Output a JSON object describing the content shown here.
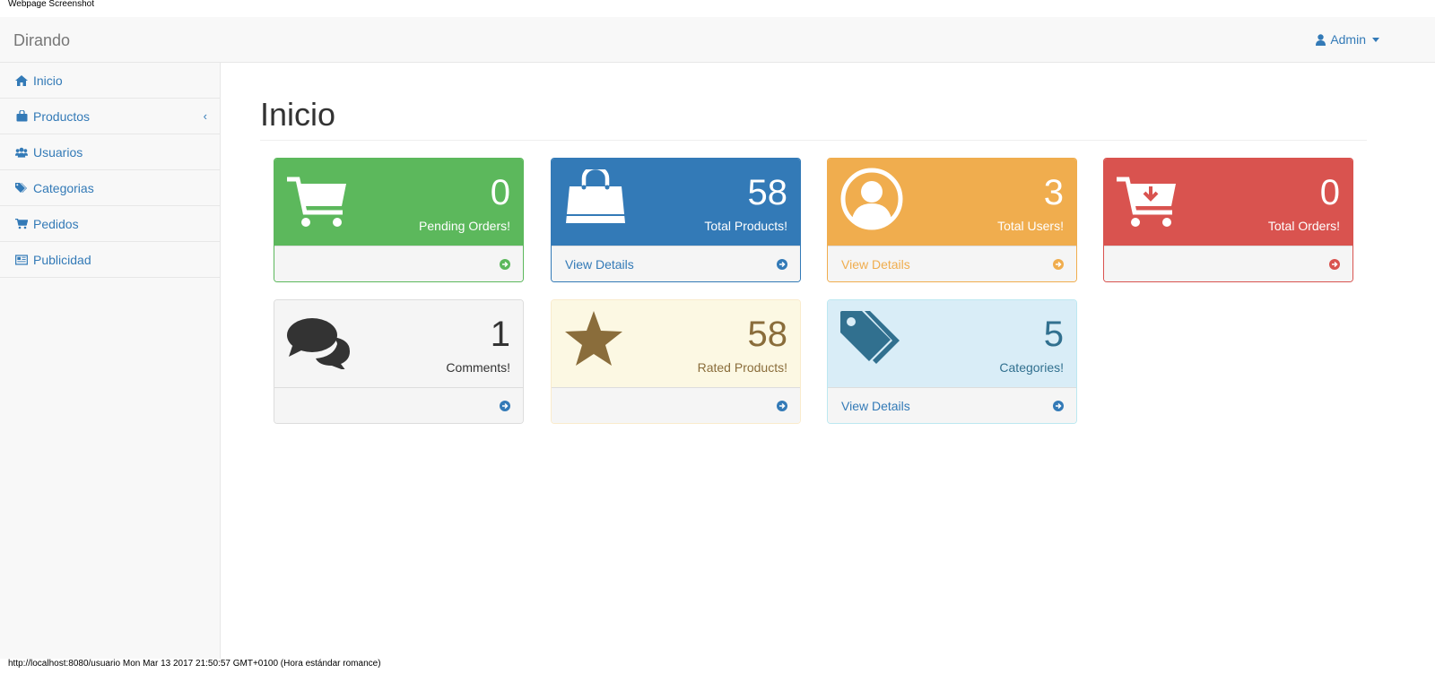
{
  "screenshot": {
    "header_text": "Webpage Screenshot",
    "footer_text": "http://localhost:8080/usuario Mon Mar 13 2017 21:50:57 GMT+0100 (Hora estándar romance)"
  },
  "navbar": {
    "brand": "Dirando",
    "user_label": "Admin",
    "user_icon": "user-icon"
  },
  "sidebar": {
    "items": [
      {
        "label": "Inicio",
        "icon": "home-icon"
      },
      {
        "label": "Productos",
        "icon": "shopping-bag-icon",
        "expand_arrow": "‹"
      },
      {
        "label": "Usuarios",
        "icon": "users-icon"
      },
      {
        "label": "Categorias",
        "icon": "tags-icon"
      },
      {
        "label": "Pedidos",
        "icon": "cart-icon"
      },
      {
        "label": "Publicidad",
        "icon": "newspaper-icon"
      }
    ]
  },
  "main": {
    "title": "Inicio",
    "panels": [
      {
        "count": "0",
        "label": "Pending Orders!",
        "footer": "",
        "icon": "shopping-cart-icon",
        "color": "#5cb85c"
      },
      {
        "count": "58",
        "label": "Total Products!",
        "footer": "View Details",
        "icon": "shopping-bag-icon",
        "color": "#337ab7"
      },
      {
        "count": "3",
        "label": "Total Users!",
        "footer": "View Details",
        "icon": "user-circle-icon",
        "color": "#f0ad4e"
      },
      {
        "count": "0",
        "label": "Total Orders!",
        "footer": "",
        "icon": "cart-arrow-down-icon",
        "color": "#d9534f"
      },
      {
        "count": "1",
        "label": "Comments!",
        "footer": "",
        "icon": "comments-icon",
        "color": "#337ab7"
      },
      {
        "count": "58",
        "label": "Rated Products!",
        "footer": "",
        "icon": "star-icon",
        "color": "#8a6d3b"
      },
      {
        "count": "5",
        "label": "Categories!",
        "footer": "View Details",
        "icon": "tags-icon",
        "color": "#31708f"
      }
    ]
  }
}
